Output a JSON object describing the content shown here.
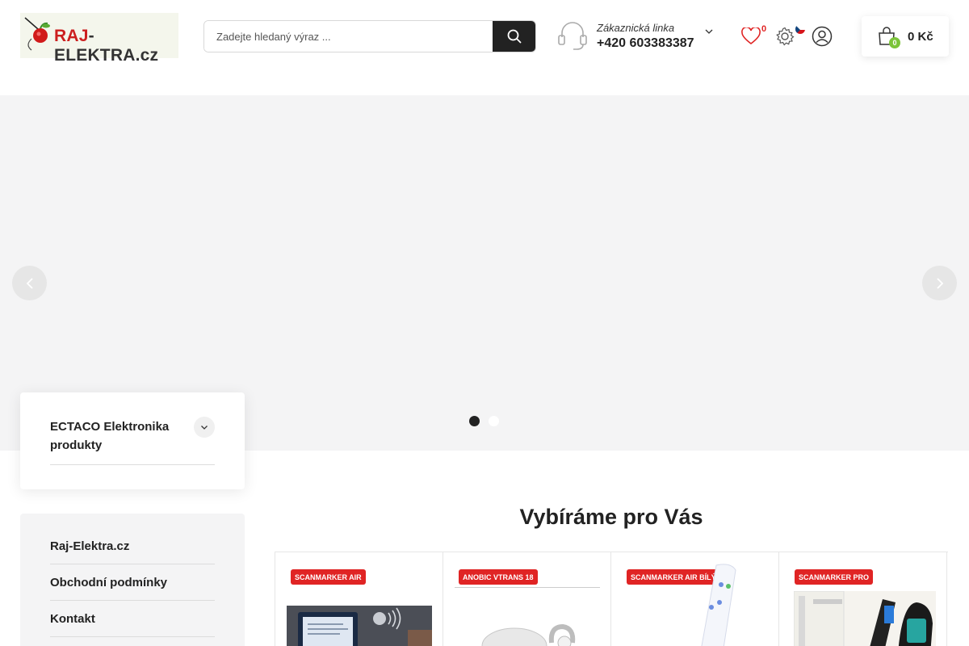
{
  "header": {
    "logo": {
      "brand_a": "RAJ",
      "brand_b": "-ELEKTRA.cz"
    },
    "search": {
      "placeholder": "Zadejte hledaný výraz ..."
    },
    "support": {
      "label": "Zákaznická linka",
      "phone": "+420 603383387"
    },
    "wishlist_count": "0",
    "cart": {
      "count": "0",
      "total": "0 Kč"
    }
  },
  "hero": {
    "slides_total": 2,
    "active_slide": 1
  },
  "sidebar": {
    "categories": [
      {
        "label": "ECTACO Elektronika produkty"
      }
    ],
    "links": [
      {
        "label": "Raj-Elektra.cz"
      },
      {
        "label": "Obchodní podmínky"
      },
      {
        "label": "Kontakt"
      }
    ]
  },
  "products_section": {
    "title": "Vybíráme pro Vás",
    "items": [
      {
        "tag": "SCANMARKER AIR"
      },
      {
        "tag": "ANOBIC VTRANS 18"
      },
      {
        "tag": "SCANMARKER AIR BÍLÝ"
      },
      {
        "tag": "SCANMARKER PRO"
      }
    ]
  },
  "colors": {
    "accent_red": "#e02424",
    "cart_badge_green": "#7cc43a",
    "dark": "#222222"
  }
}
